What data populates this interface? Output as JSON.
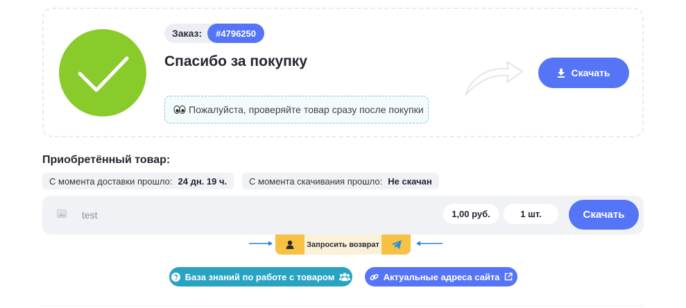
{
  "order": {
    "label": "Заказ:",
    "number": "#4796250",
    "title": "Спасибо за покупку",
    "notice": "Пожалуйста, проверяйте товар сразу после покупки",
    "download_label": "Скачать"
  },
  "purchased": {
    "title": "Приобретённый товар:",
    "stats": [
      {
        "label": "С момента доставки прошло:",
        "value": "24 дн. 19 ч."
      },
      {
        "label": "С момента скачивания прошло:",
        "value": "Не скачан"
      }
    ]
  },
  "product": {
    "name": "test",
    "price": "1,00 руб.",
    "quantity": "1 шт.",
    "download_label": "Скачать"
  },
  "return_request": {
    "label": "Запросить возврат"
  },
  "links": {
    "knowledge_base": "База знаний по работе с товаром",
    "site_addresses": "Актуальные адреса сайта"
  },
  "colors": {
    "accent": "#5675f6",
    "success": "#8acb2c",
    "teal": "#2aa3c2",
    "warning": "#f7c244"
  },
  "icons": {
    "success": "checkmark-icon",
    "notice": "eyes-icon",
    "download": "download-icon",
    "product_image": "image-placeholder-icon",
    "support": "support-agent-icon",
    "telegram": "telegram-icon",
    "question": "question-circle-icon",
    "users": "users-icon",
    "link": "link-icon",
    "external": "external-link-icon"
  }
}
